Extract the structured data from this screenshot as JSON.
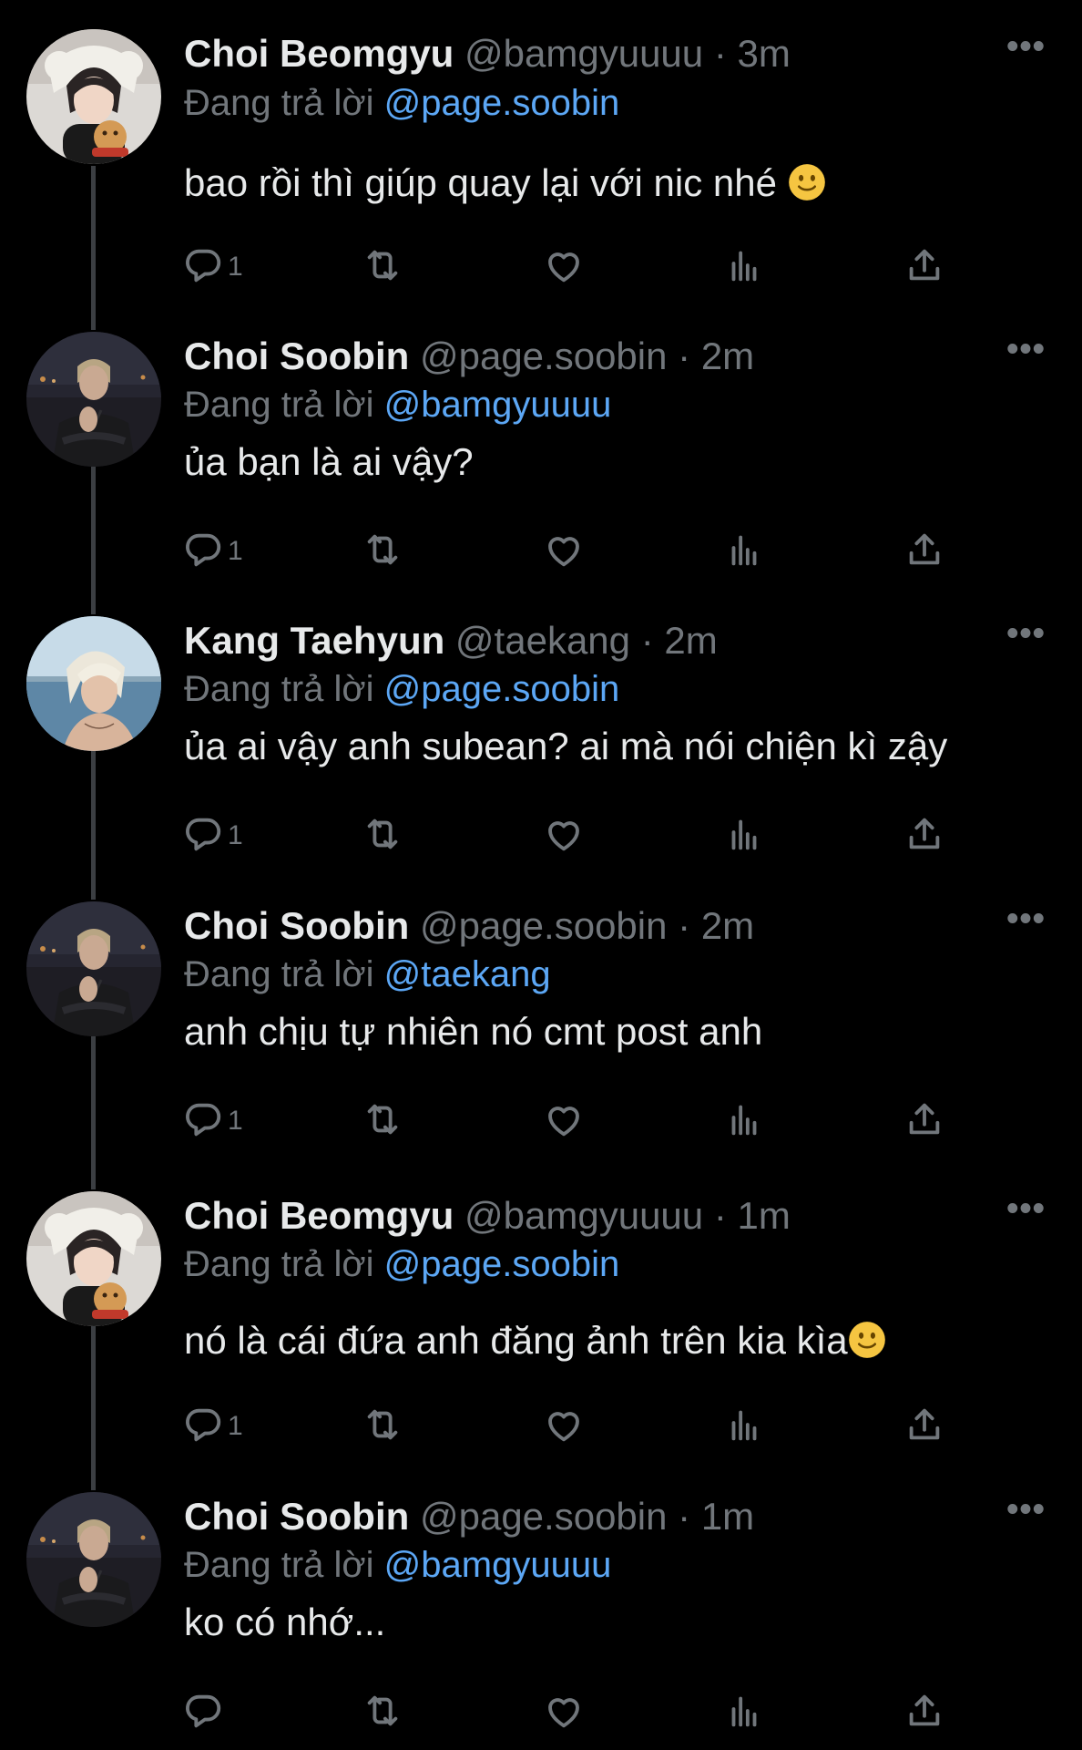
{
  "colors": {
    "background": "#000000",
    "text": "#e7e9ea",
    "muted": "#71767b",
    "mention": "#5ca7f5",
    "thread_line": "#3b3e42"
  },
  "reply_prefix": "Đang trả lời",
  "icons": {
    "reply": "reply-icon",
    "retweet": "retweet-icon",
    "like": "heart-icon",
    "views": "views-icon",
    "share": "share-icon",
    "more": "more-icon"
  },
  "tweets": [
    {
      "display_name": "Choi Beomgyu",
      "handle": "@bamgyuuuu",
      "time": "3m",
      "separator": "·",
      "more": "•••",
      "reply_to": "@page.soobin",
      "text": "bao rồi thì giúp quay lại với nic nhé ",
      "emoji": "slightly-smiling-face",
      "reply_count": "1",
      "avatar": "beomgyu"
    },
    {
      "display_name": "Choi Soobin",
      "handle": "@page.soobin",
      "time": "2m",
      "separator": "·",
      "more": "•••",
      "reply_to": "@bamgyuuuu",
      "text": "ủa bạn là ai vậy?",
      "emoji": null,
      "reply_count": "1",
      "avatar": "soobin"
    },
    {
      "display_name": "Kang Taehyun",
      "handle": "@taekang",
      "time": "2m",
      "separator": "·",
      "more": "•••",
      "reply_to": "@page.soobin",
      "text": "ủa ai vậy anh subean? ai mà nói chiện kì zậy",
      "emoji": null,
      "reply_count": "1",
      "avatar": "taehyun"
    },
    {
      "display_name": "Choi Soobin",
      "handle": "@page.soobin",
      "time": "2m",
      "separator": "·",
      "more": "•••",
      "reply_to": "@taekang",
      "text": "anh chịu tự nhiên nó cmt post anh",
      "emoji": null,
      "reply_count": "1",
      "avatar": "soobin"
    },
    {
      "display_name": "Choi Beomgyu",
      "handle": "@bamgyuuuu",
      "time": "1m",
      "separator": "·",
      "more": "•••",
      "reply_to": "@page.soobin",
      "text": "nó là cái đứa anh đăng ảnh trên kia kìa",
      "emoji": "slightly-smiling-face",
      "reply_count": "1",
      "avatar": "beomgyu"
    },
    {
      "display_name": "Choi Soobin",
      "handle": "@page.soobin",
      "time": "1m",
      "separator": "·",
      "more": "•••",
      "reply_to": "@bamgyuuuu",
      "text": "ko có nhớ...",
      "emoji": null,
      "reply_count": "",
      "avatar": "soobin"
    }
  ]
}
